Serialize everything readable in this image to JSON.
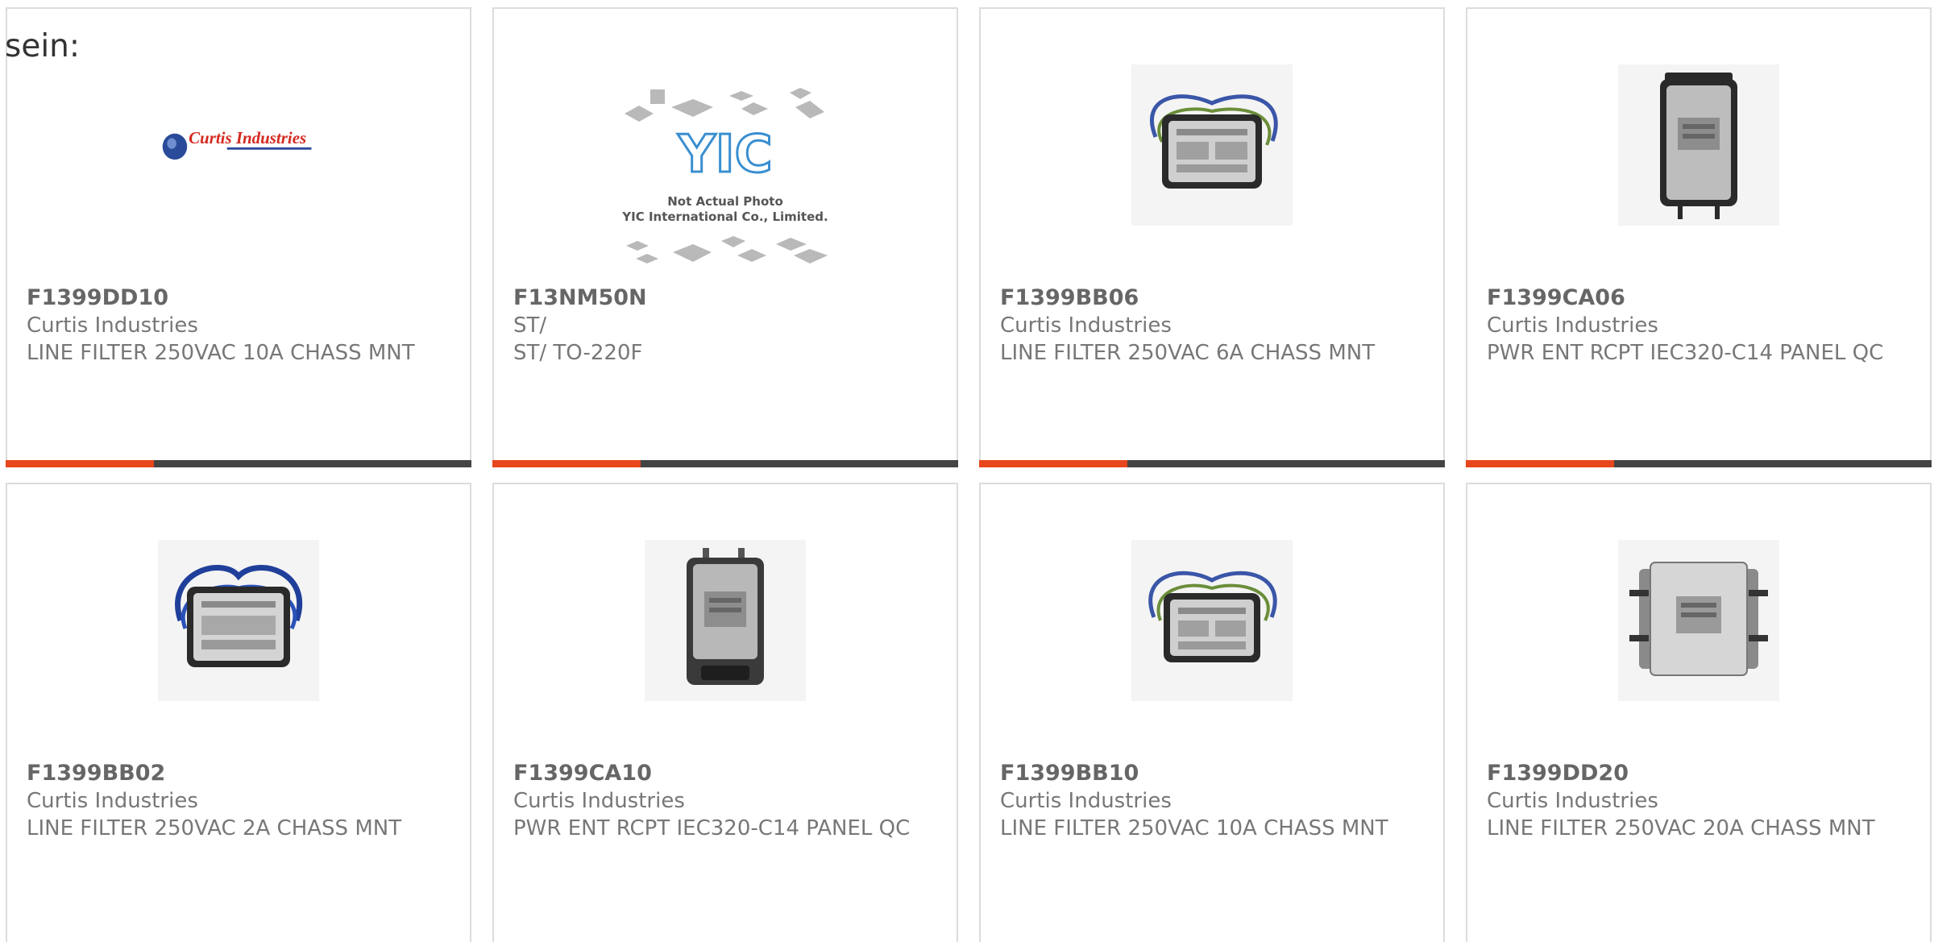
{
  "lead_text": "sein:",
  "colors": {
    "accent": "#e8461c",
    "bar": "#444444",
    "border": "#dcdcdc",
    "text": "#777777"
  },
  "products": [
    {
      "part": "F1399DD10",
      "mfr": "Curtis Industries",
      "desc": "LINE FILTER 250VAC 10A CHASS MNT",
      "image": "curtis-industries-logo"
    },
    {
      "part": "F13NM50N",
      "mfr": "ST/",
      "desc": "ST/ TO-220F",
      "image": "yic-not-actual-photo",
      "image_text": {
        "logo": "YIC",
        "line1": "Not Actual Photo",
        "line2": "YIC International Co., Limited."
      }
    },
    {
      "part": "F1399BB06",
      "mfr": "Curtis Industries",
      "desc": "LINE FILTER 250VAC 6A CHASS MNT",
      "image": "line-filter-wired"
    },
    {
      "part": "F1399CA06",
      "mfr": "Curtis Industries",
      "desc": "PWR ENT RCPT IEC320-C14 PANEL QC",
      "image": "power-entry-module"
    },
    {
      "part": "F1399BB02",
      "mfr": "Curtis Industries",
      "desc": "LINE FILTER 250VAC 2A CHASS MNT",
      "image": "line-filter-wired-blue"
    },
    {
      "part": "F1399CA10",
      "mfr": "Curtis Industries",
      "desc": "PWR ENT RCPT IEC320-C14 PANEL QC",
      "image": "power-entry-module"
    },
    {
      "part": "F1399BB10",
      "mfr": "Curtis Industries",
      "desc": "LINE FILTER 250VAC 10A CHASS MNT",
      "image": "line-filter-wired"
    },
    {
      "part": "F1399DD20",
      "mfr": "Curtis Industries",
      "desc": "LINE FILTER 250VAC 20A CHASS MNT",
      "image": "line-filter-chassis-terminals"
    }
  ]
}
